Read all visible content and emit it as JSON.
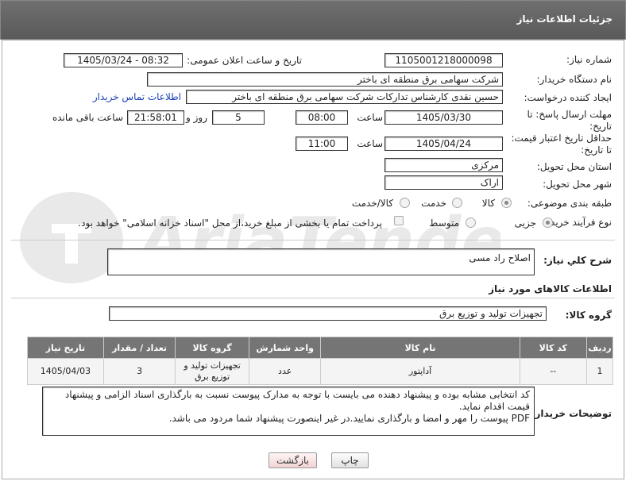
{
  "header": {
    "title": "جزئیات اطلاعات نیاز"
  },
  "form": {
    "need_number_label": "شماره نیاز:",
    "need_number": "1105001218000098",
    "announce_label": "تاریخ و ساعت اعلان عمومی:",
    "announce_value": "1405/03/24 - 08:32",
    "buyer_org_label": "نام دستگاه خریدار:",
    "buyer_org": "شرکت سهامی برق منطقه ای باختر",
    "creator_label": "ایجاد کننده درخواست:",
    "creator": "حسین نقدی کارشناس تدارکات شرکت سهامی برق منطقه ای باختر",
    "contact_link": "اطلاعات تماس خریدار",
    "deadline_label_1": "مهلت ارسال پاسخ: تا",
    "deadline_label_2": "تاریخ:",
    "deadline_date": "1405/03/30",
    "time_label": "ساعت",
    "deadline_time": "08:00",
    "days_value": "5",
    "days_label": "روز و",
    "remaining_time": "21:58:01",
    "remaining_label": "ساعت باقی مانده",
    "validity_label_1": "حداقل تاریخ اعتبار قیمت:",
    "validity_label_2": "تا تاریخ:",
    "validity_date": "1405/04/24",
    "validity_time": "11:00",
    "province_label": "استان محل تحویل:",
    "province": "مرکزی",
    "city_label": "شهر محل تحویل:",
    "city": "اراک",
    "category_label": "طبقه بندی موضوعی:",
    "category_options": [
      "کالا",
      "خدمت",
      "کالا/خدمت"
    ],
    "category_selected": "کالا",
    "process_label": "نوع فرآیند خرید :",
    "process_options": [
      "جزیی",
      "متوسط"
    ],
    "payment_note": "پرداخت تمام یا بخشی از مبلغ خرید،از محل \"اسناد خزانه اسلامی\" خواهد بود."
  },
  "summary": {
    "label": "شرح کلي نياز:",
    "value": "اصلاح راد مسی"
  },
  "goods": {
    "section_title": "اطلاعات کالاهای مورد نیاز",
    "group_label": "گروه کالا:",
    "group_value": "تجهیزات تولید و توزیع برق"
  },
  "table": {
    "headers": [
      "ردیف",
      "کد کالا",
      "نام کالا",
      "واحد شمارش",
      "گروه کالا",
      "تعداد / مقدار",
      "تاریخ نیاز"
    ],
    "rows": [
      [
        "1",
        "--",
        "آداپتور",
        "عدد",
        "تجهیزات تولید و توزیع برق",
        "3",
        "1405/04/03"
      ]
    ]
  },
  "notes": {
    "label": "توضیحات خریدار:",
    "line1": "کد انتخابی مشابه بوده و پیشنهاد دهنده می بایست با توجه به مدارک پیوست نسبت به بارگذاری اسناد الزامی و پیشنهاد",
    "line2": "قیمت اقدام نماید.",
    "line3": "PDF پیوست را مهر و امضا و بارگذاری نمایید.در غیر اینصورت پیشنهاد شما مردود می باشد."
  },
  "buttons": {
    "print": "چاپ",
    "back": "بازگشت"
  },
  "colors": {
    "header_bg": "#666666",
    "table_header_bg": "#757575",
    "link": "#1a3fb5",
    "back_button_bg": "#f1d3d3"
  },
  "icons": {
    "watermark": "aria-tender-watermark"
  }
}
